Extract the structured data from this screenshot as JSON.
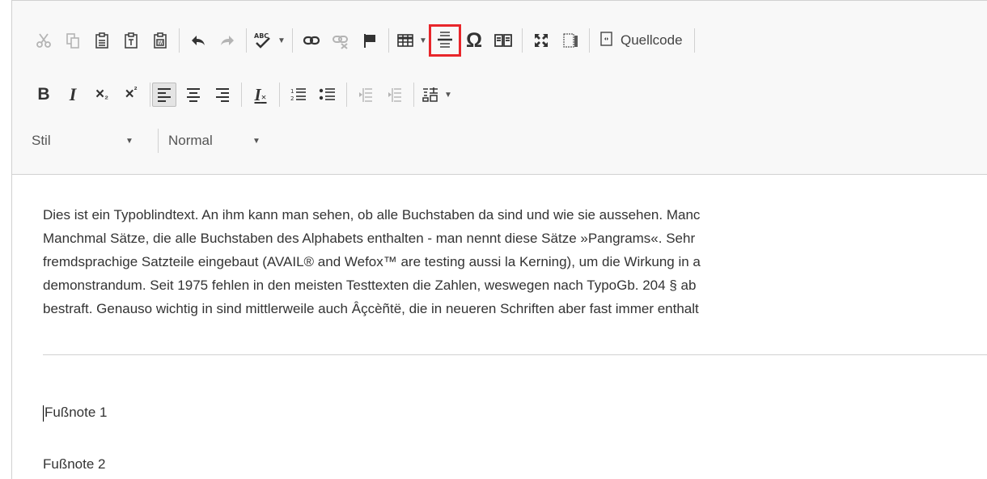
{
  "toolbar": {
    "row1": {
      "cut_icon": "scissors-icon",
      "copy_icon": "copy-icon",
      "paste_icon": "paste-icon",
      "paste_text_icon": "paste-text-icon",
      "paste_word_icon": "paste-word-icon",
      "undo_icon": "undo-icon",
      "redo_icon": "redo-icon",
      "spellcheck_icon": "spellcheck-icon",
      "spellcheck_abc": "ABC",
      "link_icon": "link-icon",
      "unlink_icon": "unlink-icon",
      "anchor_icon": "flag-icon",
      "table_icon": "table-icon",
      "hr_icon": "horizontal-line-icon",
      "special_char": "Ω",
      "book_icon": "book-icon",
      "maximize_icon": "maximize-icon",
      "blocks_icon": "show-blocks-icon",
      "source_label": "Quellcode"
    },
    "row2": {
      "bold": "B",
      "italic": "I",
      "subscript_base": "×",
      "subscript_mark": "₂",
      "superscript_base": "×",
      "superscript_mark": "²",
      "remove_format": "I",
      "remove_format_mark": "×"
    },
    "row3": {
      "style_label": "Stil",
      "format_label": "Normal"
    },
    "highlight_color": "#e8262b"
  },
  "content": {
    "lines": [
      "Dies ist ein Typoblindtext. An ihm kann man sehen, ob alle Buchstaben da sind und wie sie aussehen. Manc",
      "Manchmal Sätze, die alle Buchstaben des Alphabets enthalten - man nennt diese Sätze »Pangrams«. Sehr",
      "fremdsprachige Satzteile eingebaut (AVAIL® and Wefox™ are testing aussi la Kerning), um die Wirkung in a",
      "demonstrandum. Seit 1975 fehlen in den meisten Testtexten die Zahlen, weswegen nach TypoGb. 204 § ab",
      "bestraft. Genauso wichtig in sind mittlerweile auch Âçcèñtë, die in neueren Schriften aber fast immer enthalt"
    ],
    "footnote1": "Fußnote 1",
    "footnote2": "Fußnote 2"
  }
}
